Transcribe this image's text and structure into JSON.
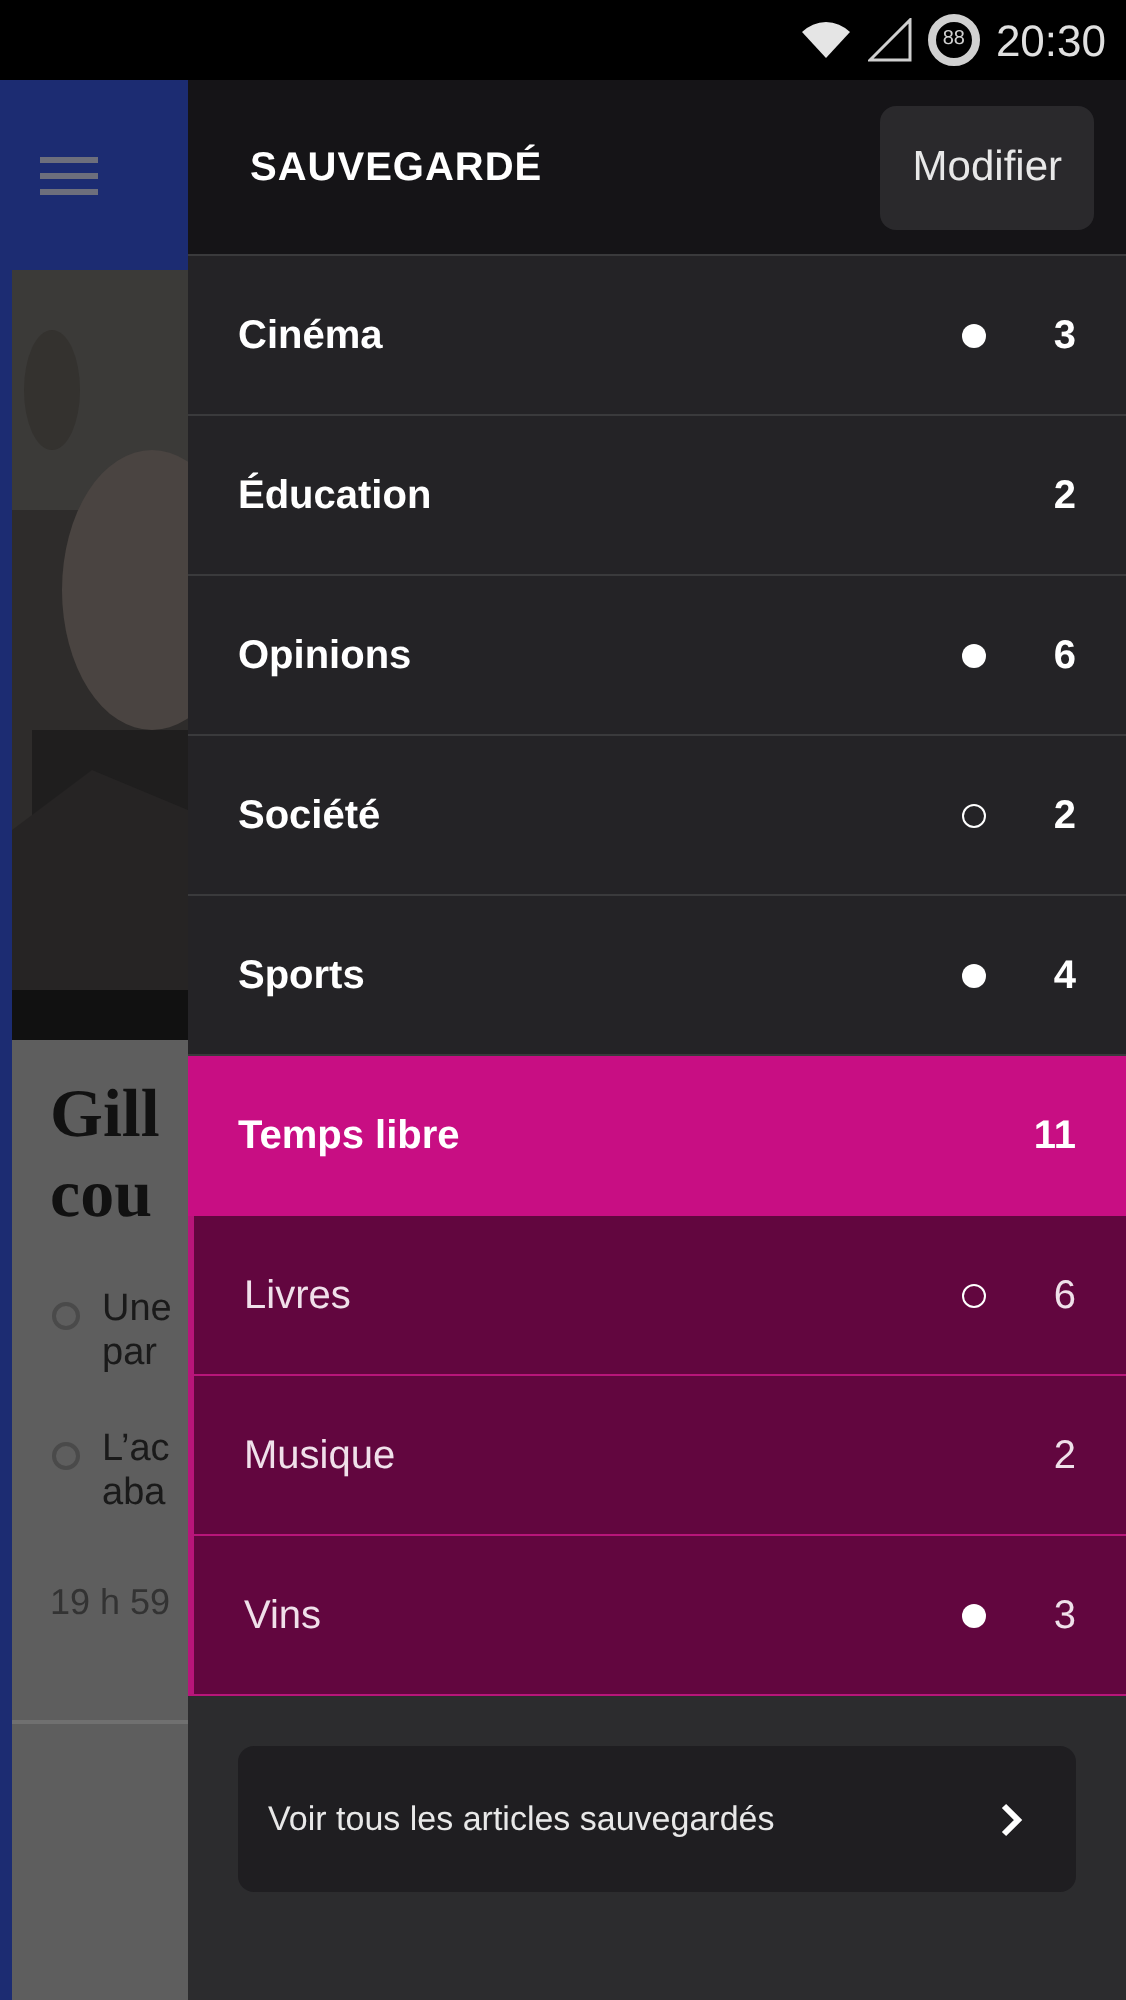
{
  "status_bar": {
    "time": "20:30",
    "battery": "88"
  },
  "background_article": {
    "headline": [
      "Gill",
      "cou"
    ],
    "bullets": [
      [
        "Une",
        "par"
      ],
      [
        "L’ac",
        "aba"
      ]
    ],
    "time": "19 h 59"
  },
  "drawer": {
    "title": "SAUVEGARDÉ",
    "edit_button": "Modifier",
    "items": [
      {
        "kind": "category",
        "label": "Cinéma",
        "count": "3",
        "dot": true,
        "dot_filled": true,
        "selected": false
      },
      {
        "kind": "category",
        "label": "Éducation",
        "count": "2",
        "dot": false,
        "selected": false
      },
      {
        "kind": "category",
        "label": "Opinions",
        "count": "6",
        "dot": true,
        "dot_filled": true,
        "selected": false
      },
      {
        "kind": "category",
        "label": "Société",
        "count": "2",
        "dot": true,
        "dot_filled": false,
        "selected": false
      },
      {
        "kind": "category",
        "label": "Sports",
        "count": "4",
        "dot": true,
        "dot_filled": true,
        "selected": false
      },
      {
        "kind": "category",
        "label": "Temps libre",
        "count": "11",
        "dot": false,
        "selected": true
      },
      {
        "kind": "subcategory",
        "label": "Livres",
        "count": "6",
        "dot": true,
        "dot_filled": false,
        "selected": false
      },
      {
        "kind": "subcategory",
        "label": "Musique",
        "count": "2",
        "dot": false,
        "selected": false
      },
      {
        "kind": "subcategory",
        "label": "Vins",
        "count": "3",
        "dot": true,
        "dot_filled": true,
        "selected": false
      }
    ],
    "footer_link": "Voir tous les articles sauvegardés"
  }
}
